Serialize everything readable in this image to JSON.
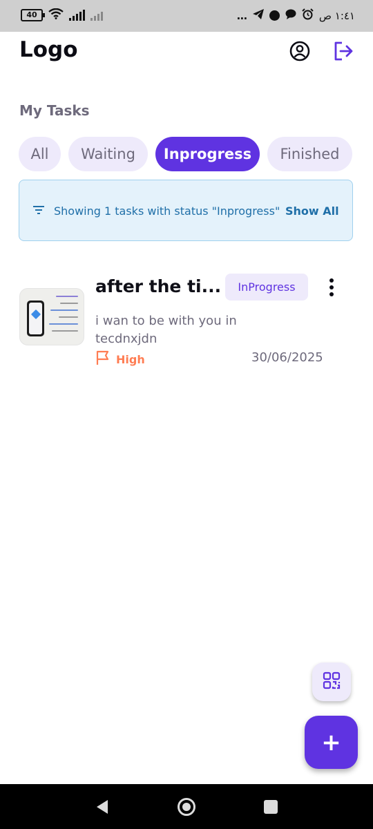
{
  "status_bar": {
    "battery": "40",
    "time": "١:٤١ ص",
    "dots": "…"
  },
  "header": {
    "logo": "Logo",
    "icons": [
      "profile-icon",
      "logout-icon"
    ]
  },
  "section_title": "My Tasks",
  "tabs": [
    {
      "label": "All",
      "active": false
    },
    {
      "label": "Waiting",
      "active": false
    },
    {
      "label": "Inprogress",
      "active": true
    },
    {
      "label": "Finished",
      "active": false
    }
  ],
  "banner": {
    "text": "Showing 1 tasks with status \"Inprogress\"",
    "link": "Show All"
  },
  "tasks": [
    {
      "title": "after the ti...",
      "status": "InProgress",
      "description": " i wan to be with you in tecdnxjdn",
      "priority": "High",
      "date": "30/06/2025"
    }
  ],
  "fabs": {
    "add": "+",
    "icons": [
      "qr-code-icon",
      "plus-icon"
    ]
  },
  "colors": {
    "primary": "#5f33e1",
    "chip_bg": "#eeeafb",
    "priority_high": "#ff7d53",
    "banner_bg": "#e4f2fb",
    "banner_text": "#1f6fa8"
  }
}
